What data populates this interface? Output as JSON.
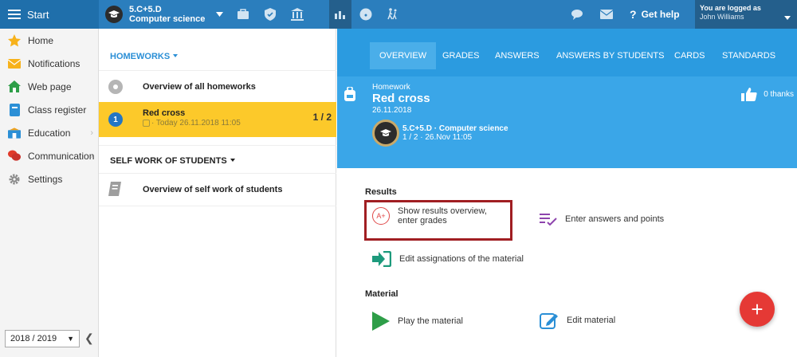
{
  "topbar": {
    "start_label": "Start",
    "class_name": "5.C+5.D",
    "subject": "Computer science",
    "help_label": "Get help",
    "logged_label": "You are logged as",
    "user_name": "John Williams"
  },
  "sidebar": {
    "items": [
      {
        "label": "Home",
        "icon": "star-icon"
      },
      {
        "label": "Notifications",
        "icon": "envelope-icon"
      },
      {
        "label": "Web page",
        "icon": "house-icon"
      },
      {
        "label": "Class register",
        "icon": "register-icon"
      },
      {
        "label": "Education",
        "icon": "education-icon"
      },
      {
        "label": "Communication",
        "icon": "chat-icon"
      },
      {
        "label": "Settings",
        "icon": "gear-icon"
      }
    ],
    "year": "2018 / 2019"
  },
  "homeworks": {
    "title": "HOMEWORKS",
    "overview": "Overview of all homeworks",
    "active": {
      "number": "1",
      "title": "Red cross",
      "date": "· Today 26.11.2018 11:05",
      "count": "1 / 2"
    },
    "self_title": "SELF WORK OF STUDENTS",
    "self_overview": "Overview of self work of students"
  },
  "tabs": [
    "OVERVIEW",
    "GRADES",
    "ANSWERS",
    "ANSWERS BY STUDENTS",
    "CARDS",
    "STANDARDS"
  ],
  "homework": {
    "kind": "Homework",
    "title": "Red cross",
    "date": "26.11.2018",
    "class": "5.C+5.D · Computer science",
    "meta": "1 / 2 · 26.Nov 11:05",
    "thanks": "0 thanks"
  },
  "results": {
    "heading": "Results",
    "show_results": "Show results overview, enter grades",
    "enter_answers": "Enter answers and points",
    "edit_assign": "Edit assignations of the material"
  },
  "material": {
    "heading": "Material",
    "play": "Play the material",
    "edit": "Edit material"
  },
  "fab_label": "+",
  "colors": {
    "primary": "#2b9be0",
    "accent": "#fcc92a",
    "danger": "#e53935",
    "highlight": "#a01e22"
  }
}
